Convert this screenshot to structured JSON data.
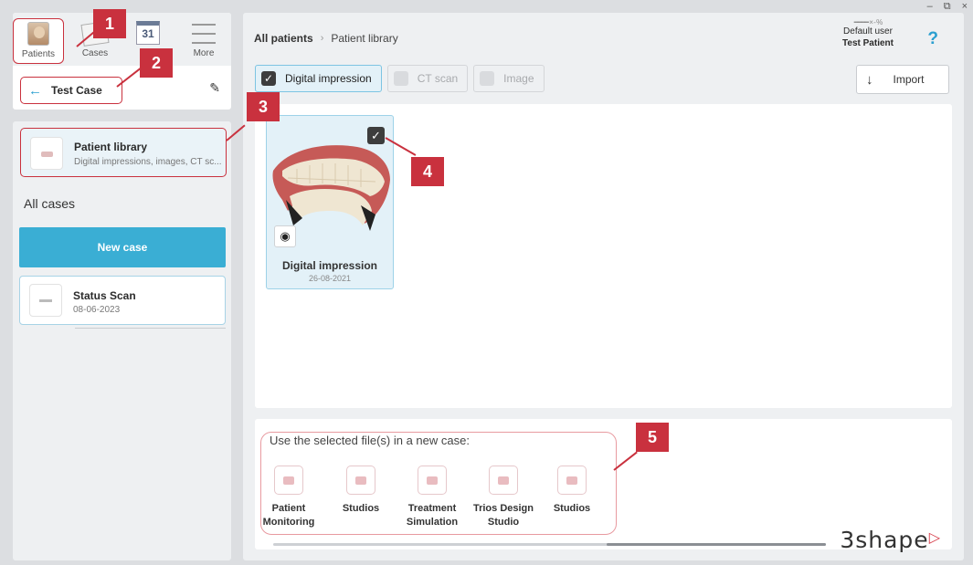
{
  "window": {
    "minimize": "–",
    "restore": "⧉",
    "close": "×"
  },
  "nav": [
    {
      "label": "Patients",
      "icon": "patient-avatar-icon"
    },
    {
      "label": "Cases",
      "icon": "cases-icon"
    },
    {
      "label": "Ca",
      "icon": "calendar-icon",
      "icon_text": "31"
    },
    {
      "label": "More",
      "icon": "menu-icon"
    }
  ],
  "case": {
    "back": "←",
    "name": "Test Case",
    "edit": "✎"
  },
  "patient_library": {
    "title": "Patient library",
    "subtitle": "Digital impressions, images, CT sc..."
  },
  "all_cases": "All cases",
  "new_case": "New case",
  "cases": [
    {
      "title": "Status Scan",
      "date": "08-06-2023"
    }
  ],
  "breadcrumb": {
    "root": "All patients",
    "separator": "›",
    "current": "Patient library"
  },
  "user": {
    "signature": "━━━━ × - %",
    "line1": "Default user",
    "line2": "Test Patient"
  },
  "help": "?",
  "filters": [
    {
      "label": "Digital impression",
      "checked": true
    },
    {
      "label": "CT scan",
      "checked": false
    },
    {
      "label": "Image",
      "checked": false
    }
  ],
  "import": {
    "icon": "↓",
    "label": "Import"
  },
  "impression_card": {
    "title": "Digital impression",
    "date": "26-08-2021",
    "check": "✓",
    "view_icon": "eye-icon"
  },
  "use_selected": "Use the selected file(s) in a new case:",
  "apps": [
    {
      "line1": "Patient",
      "line2": "Monitoring"
    },
    {
      "line1": "Studios",
      "line2": ""
    },
    {
      "line1": "Treatment",
      "line2": "Simulation"
    },
    {
      "line1": "Trios Design",
      "line2": "Studio"
    },
    {
      "line1": "Studios",
      "line2": ""
    }
  ],
  "logo": {
    "text": "3shape",
    "mark": "▷"
  },
  "callouts": [
    "1",
    "2",
    "3",
    "4",
    "5"
  ],
  "colors": {
    "accent": "#3aaed4",
    "annotation": "#c9313e",
    "panel": "#eef0f2"
  }
}
